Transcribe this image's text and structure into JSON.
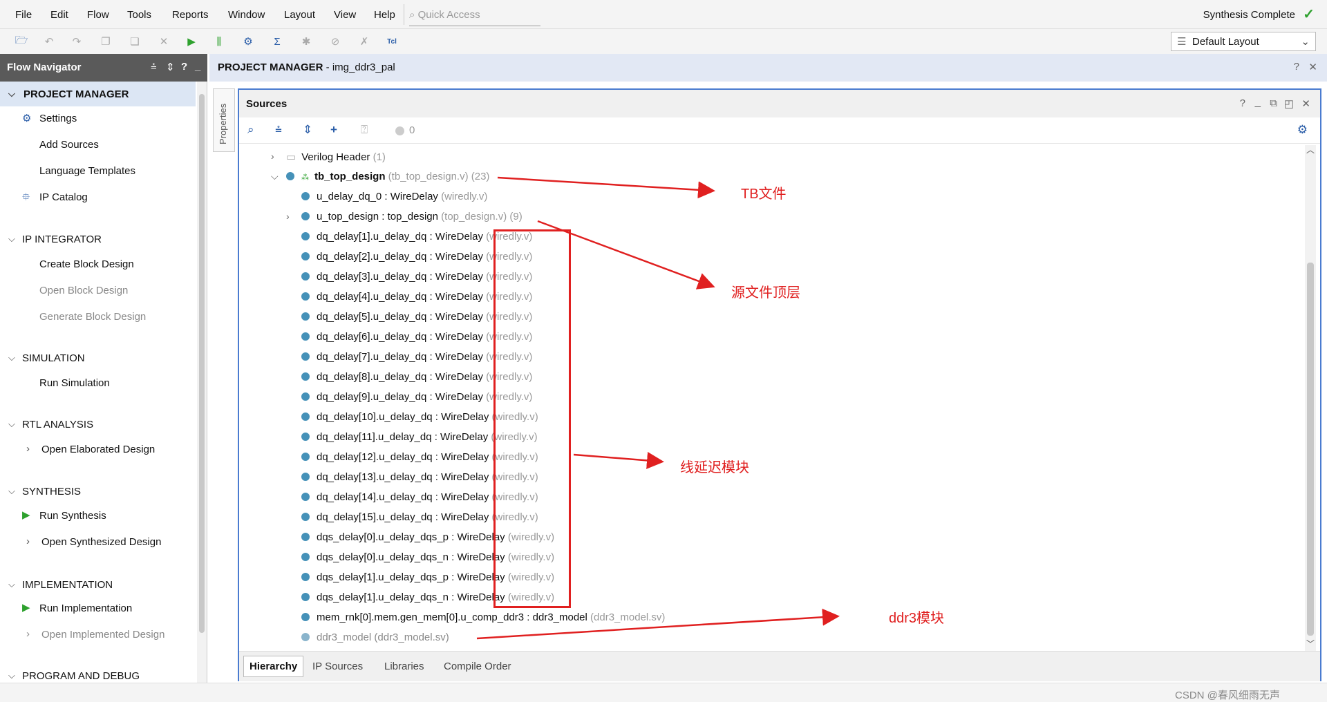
{
  "menubar": {
    "items": [
      "File",
      "Edit",
      "Flow",
      "Tools",
      "Reports",
      "Window",
      "Layout",
      "View",
      "Help"
    ],
    "quick_access": "Quick Access",
    "status": "Synthesis Complete"
  },
  "toolbar": {
    "layout_select": "Default Layout"
  },
  "flow_navigator": {
    "title": "Flow Navigator",
    "project_manager": "PROJECT MANAGER",
    "settings": "Settings",
    "add_sources": "Add Sources",
    "language_templates": "Language Templates",
    "ip_catalog": "IP Catalog",
    "ip_integrator": "IP INTEGRATOR",
    "create_block_design": "Create Block Design",
    "open_block_design": "Open Block Design",
    "generate_block_design": "Generate Block Design",
    "simulation": "SIMULATION",
    "run_simulation": "Run Simulation",
    "rtl_analysis": "RTL ANALYSIS",
    "open_elaborated_design": "Open Elaborated Design",
    "synthesis": "SYNTHESIS",
    "run_synthesis": "Run Synthesis",
    "open_synthesized_design": "Open Synthesized Design",
    "implementation": "IMPLEMENTATION",
    "run_implementation": "Run Implementation",
    "open_implemented_design": "Open Implemented Design",
    "program_and_debug": "PROGRAM AND DEBUG"
  },
  "main": {
    "header_title": "PROJECT MANAGER",
    "header_project": " - img_ddr3_pal",
    "properties_tab": "Properties",
    "sources_title": "Sources",
    "warning_count": "0"
  },
  "tree": [
    {
      "name": "Verilog Header",
      "file": " (1)",
      "indent": 0,
      "expander": ">",
      "dot": false,
      "folder": true
    },
    {
      "name": "tb_top_design",
      "file": " (tb_top_design.v) (23)",
      "indent": 0,
      "expander": "v",
      "dot": true,
      "bold": true
    },
    {
      "name": "u_delay_dq_0 : WireDelay",
      "file": " (wiredly.v)",
      "indent": 1
    },
    {
      "name": "u_top_design : top_design",
      "file": " (top_design.v) (9)",
      "indent": 1,
      "expander": ">"
    },
    {
      "name": "dq_delay[1].u_delay_dq : WireDelay",
      "file": " (wiredly.v)",
      "indent": 1
    },
    {
      "name": "dq_delay[2].u_delay_dq : WireDelay",
      "file": " (wiredly.v)",
      "indent": 1
    },
    {
      "name": "dq_delay[3].u_delay_dq : WireDelay",
      "file": " (wiredly.v)",
      "indent": 1
    },
    {
      "name": "dq_delay[4].u_delay_dq : WireDelay",
      "file": " (wiredly.v)",
      "indent": 1
    },
    {
      "name": "dq_delay[5].u_delay_dq : WireDelay",
      "file": " (wiredly.v)",
      "indent": 1
    },
    {
      "name": "dq_delay[6].u_delay_dq : WireDelay",
      "file": " (wiredly.v)",
      "indent": 1
    },
    {
      "name": "dq_delay[7].u_delay_dq : WireDelay",
      "file": " (wiredly.v)",
      "indent": 1
    },
    {
      "name": "dq_delay[8].u_delay_dq : WireDelay",
      "file": " (wiredly.v)",
      "indent": 1
    },
    {
      "name": "dq_delay[9].u_delay_dq : WireDelay",
      "file": " (wiredly.v)",
      "indent": 1
    },
    {
      "name": "dq_delay[10].u_delay_dq : WireDelay",
      "file": " (wiredly.v)",
      "indent": 1
    },
    {
      "name": "dq_delay[11].u_delay_dq : WireDelay",
      "file": " (wiredly.v)",
      "indent": 1
    },
    {
      "name": "dq_delay[12].u_delay_dq : WireDelay",
      "file": " (wiredly.v)",
      "indent": 1
    },
    {
      "name": "dq_delay[13].u_delay_dq : WireDelay",
      "file": " (wiredly.v)",
      "indent": 1
    },
    {
      "name": "dq_delay[14].u_delay_dq : WireDelay",
      "file": " (wiredly.v)",
      "indent": 1
    },
    {
      "name": "dq_delay[15].u_delay_dq : WireDelay",
      "file": " (wiredly.v)",
      "indent": 1
    },
    {
      "name": "dqs_delay[0].u_delay_dqs_p : WireDelay",
      "file": " (wiredly.v)",
      "indent": 1
    },
    {
      "name": "dqs_delay[0].u_delay_dqs_n : WireDelay",
      "file": " (wiredly.v)",
      "indent": 1
    },
    {
      "name": "dqs_delay[1].u_delay_dqs_p : WireDelay",
      "file": " (wiredly.v)",
      "indent": 1
    },
    {
      "name": "dqs_delay[1].u_delay_dqs_n : WireDelay",
      "file": " (wiredly.v)",
      "indent": 1
    },
    {
      "name": "mem_rnk[0].mem.gen_mem[0].u_comp_ddr3 : ddr3_model",
      "file": " (ddr3_model.sv)",
      "indent": 1
    },
    {
      "name": "ddr3_model (ddr3_model.sv)",
      "file": "",
      "indent": 1,
      "dim": true
    }
  ],
  "source_tabs": [
    "Hierarchy",
    "IP Sources",
    "Libraries",
    "Compile Order"
  ],
  "annotations": {
    "tb": "TB文件",
    "top": "源文件顶层",
    "wire": "线延迟模块",
    "ddr3": "ddr3模块",
    "watermark": "CSDN @春风细雨无声"
  },
  "colors": {
    "annotation": "#e02020",
    "accent": "#4a7bd0",
    "dot": "#4591b8",
    "header": "#5a5a5a"
  }
}
